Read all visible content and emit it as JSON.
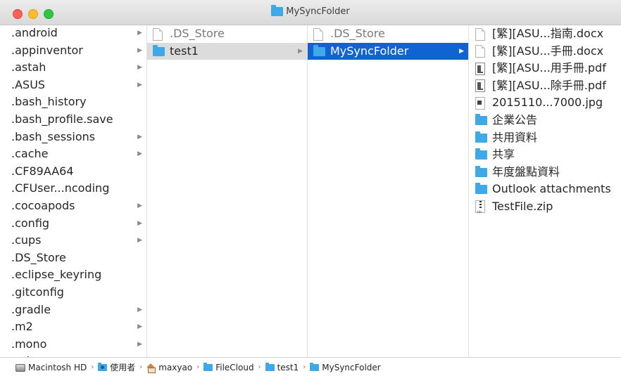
{
  "window": {
    "title": "MySyncFolder"
  },
  "column1": {
    "items": [
      {
        "label": ".android",
        "has_children": true
      },
      {
        "label": ".appinventor",
        "has_children": true
      },
      {
        "label": ".astah",
        "has_children": true
      },
      {
        "label": ".ASUS",
        "has_children": true
      },
      {
        "label": ".bash_history",
        "has_children": false
      },
      {
        "label": ".bash_profile.save",
        "has_children": false
      },
      {
        "label": ".bash_sessions",
        "has_children": true
      },
      {
        "label": ".cache",
        "has_children": true
      },
      {
        "label": ".CF89AA64",
        "has_children": false
      },
      {
        "label": ".CFUser...ncoding",
        "has_children": false
      },
      {
        "label": ".cocoapods",
        "has_children": true
      },
      {
        "label": ".config",
        "has_children": true
      },
      {
        "label": ".cups",
        "has_children": true
      },
      {
        "label": ".DS_Store",
        "has_children": false
      },
      {
        "label": ".eclipse_keyring",
        "has_children": false
      },
      {
        "label": ".gitconfig",
        "has_children": false
      },
      {
        "label": ".gradle",
        "has_children": true
      },
      {
        "label": ".m2",
        "has_children": true
      },
      {
        "label": ".mono",
        "has_children": true
      },
      {
        "label": ".ssh",
        "has_children": true
      }
    ]
  },
  "column2": {
    "items": [
      {
        "label": ".DS_Store",
        "icon": "blank-file-icon"
      },
      {
        "label": "test1",
        "icon": "folder-icon",
        "selected": true
      }
    ]
  },
  "column3": {
    "items": [
      {
        "label": ".DS_Store",
        "icon": "blank-file-icon"
      },
      {
        "label": "MySyncFolder",
        "icon": "folder-icon",
        "selected": true
      }
    ]
  },
  "column4": {
    "items": [
      {
        "label": "[繁][ASU...指南.docx",
        "icon": "blank-file-icon"
      },
      {
        "label": "[繁][ASU...手冊.docx",
        "icon": "blank-file-icon"
      },
      {
        "label": "[繁][ASU...用手冊.pdf",
        "icon": "pdf-file-icon"
      },
      {
        "label": "[繁][ASU...除手冊.pdf",
        "icon": "pdf-file-icon"
      },
      {
        "label": "2015110...7000.jpg",
        "icon": "image-file-icon"
      },
      {
        "label": "企業公告",
        "icon": "folder-icon"
      },
      {
        "label": "共用資料",
        "icon": "folder-icon"
      },
      {
        "label": "共享",
        "icon": "folder-icon"
      },
      {
        "label": "年度盤點資料",
        "icon": "folder-icon"
      },
      {
        "label": "Outlook attachments",
        "icon": "folder-icon"
      },
      {
        "label": "TestFile.zip",
        "icon": "zip-file-icon"
      }
    ]
  },
  "pathbar": {
    "segments": [
      {
        "label": "Macintosh HD",
        "icon": "hard-drive-icon"
      },
      {
        "label": "使用者",
        "icon": "users-folder-icon"
      },
      {
        "label": "maxyao",
        "icon": "home-icon"
      },
      {
        "label": "FileCloud",
        "icon": "folder-icon"
      },
      {
        "label": "test1",
        "icon": "folder-icon"
      },
      {
        "label": "MySyncFolder",
        "icon": "folder-icon"
      }
    ],
    "separator": "›"
  },
  "colors": {
    "selection_active": "#0f64d2",
    "selection_inactive": "#dcdcdc",
    "folder": "#3fa9e8"
  }
}
